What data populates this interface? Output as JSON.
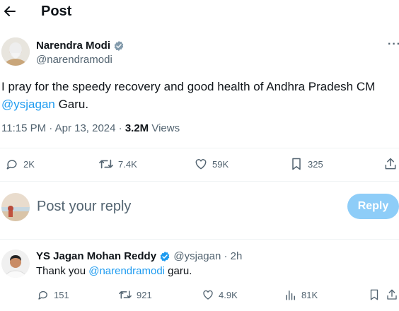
{
  "header": {
    "title": "Post"
  },
  "post": {
    "author_name": "Narendra Modi",
    "author_handle": "@narendramodi",
    "text_before": "I pray for the speedy recovery and good health of Andhra Pradesh CM",
    "mention": "@ysjagan",
    "text_after": " Garu.",
    "time": "11:15 PM · Apr 13, 2024 · ",
    "views_count": "3.2M",
    "views_label": " Views",
    "stats": {
      "replies": "2K",
      "reposts": "7.4K",
      "likes": "59K",
      "bookmarks": "325"
    }
  },
  "composer": {
    "placeholder": "Post your reply",
    "button_label": "Reply"
  },
  "reply": {
    "author_name": "YS Jagan Mohan Reddy",
    "author_handle": "@ysjagan",
    "time": " · 2h",
    "text_before": "Thank you ",
    "mention": "@narendramodi",
    "text_after": " garu.",
    "stats": {
      "replies": "151",
      "reposts": "921",
      "likes": "4.9K",
      "views": "81K"
    }
  },
  "colors": {
    "accent": "#1d9bf0",
    "reply_button": "#8ecdf8",
    "text": "#0f1419",
    "muted": "#536471",
    "divider": "#eff3f4"
  }
}
